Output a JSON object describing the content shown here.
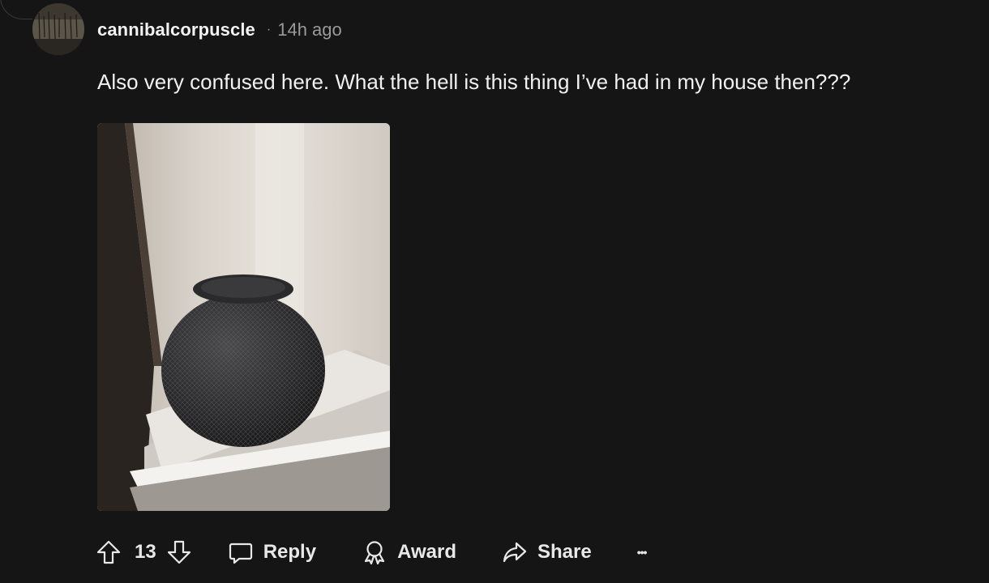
{
  "comment": {
    "author": "cannibalcorpuscle",
    "separator": "·",
    "time_ago": "14h ago",
    "text": "Also very confused here. What the hell is this thing I’ve had in my house then???"
  },
  "actions": {
    "score": "13",
    "reply_label": "Reply",
    "award_label": "Award",
    "share_label": "Share",
    "more_label": "•••"
  },
  "icons": {
    "upvote": "arrow-up-icon",
    "downvote": "arrow-down-icon",
    "reply": "speech-bubble-icon",
    "award": "award-ribbon-icon",
    "share": "share-arrow-icon",
    "more": "ellipsis-icon"
  },
  "colors": {
    "background": "#151515",
    "text_primary": "#f0f0f0",
    "text_secondary": "#9a9a9a"
  }
}
